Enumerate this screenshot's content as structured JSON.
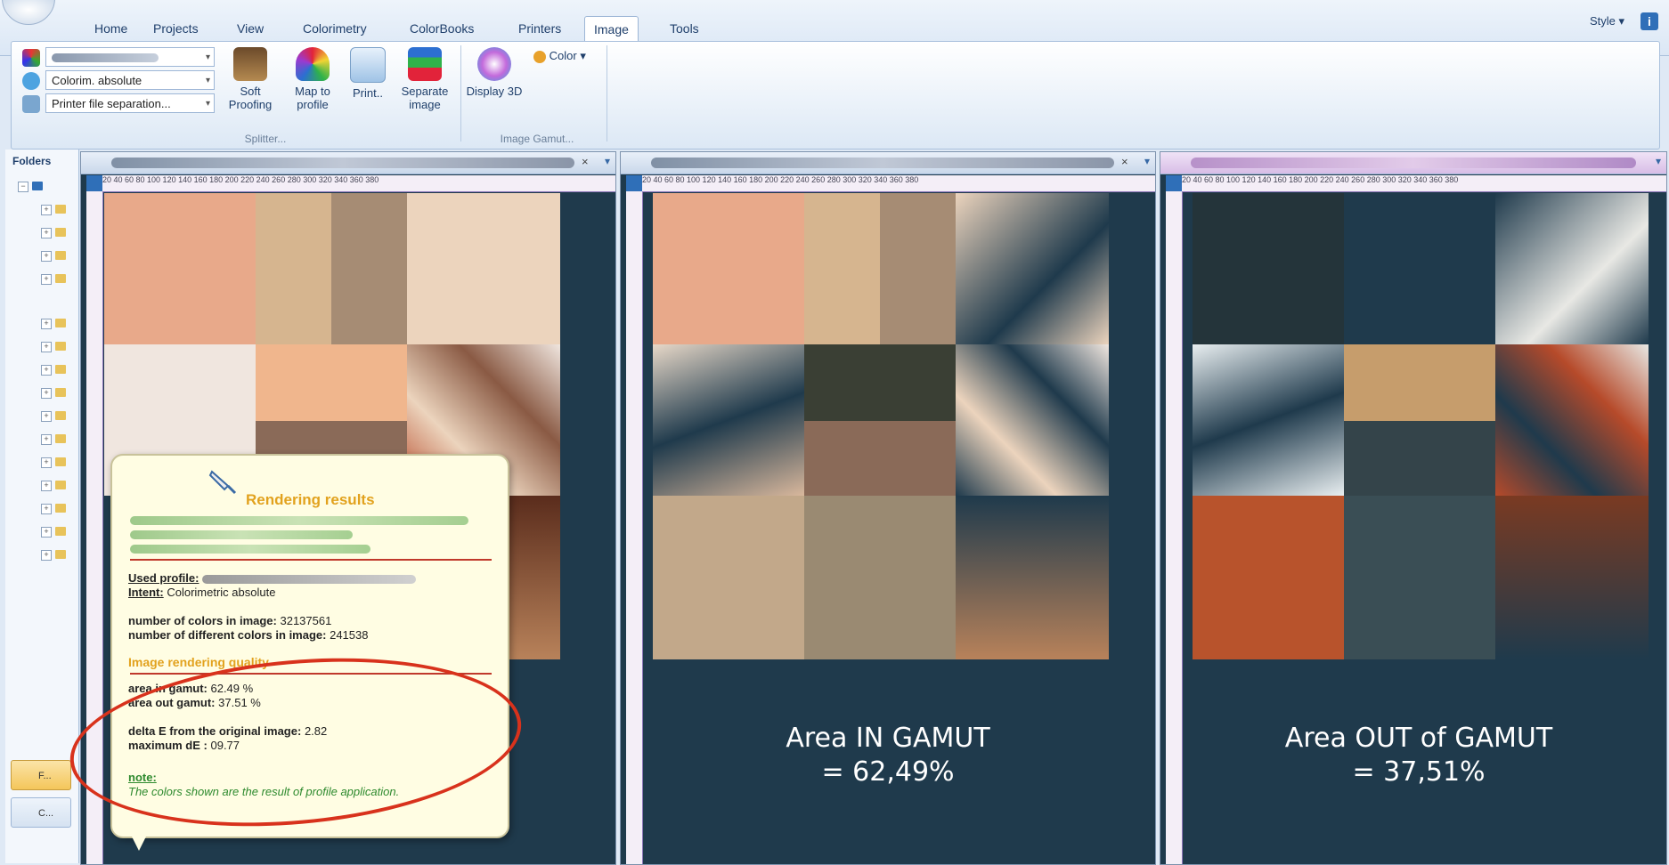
{
  "ribbon": {
    "tabs": [
      "Home",
      "Projects",
      "View",
      "Colorimetry",
      "ColorBooks",
      "Printers",
      "Image",
      "Tools"
    ],
    "active_tab": "Image",
    "style_label": "Style",
    "combos": [
      "",
      "Colorim. absolute",
      "Printer file separation..."
    ],
    "buttons": {
      "soft_proofing": "Soft Proofing",
      "map_to_profile": "Map to profile",
      "print": "Print..",
      "separate_image": "Separate image",
      "display_3d": "Display 3D",
      "color": "Color"
    },
    "groups": {
      "splitter": "Splitter...",
      "image_gamut": "Image Gamut..."
    }
  },
  "folders": {
    "title": "Folders",
    "btn1": "F...",
    "btn2": "C..."
  },
  "ruler_ticks": "20  40  60  80  100 120 140 160 180 200 220 240 260 280 300 320 340 360 380",
  "panels": {
    "middle_caption_1": "Area IN GAMUT",
    "middle_caption_2": "= 62,49%",
    "right_caption_1": "Area OUT of GAMUT",
    "right_caption_2": "= 37,51%"
  },
  "popup": {
    "title": "Rendering results",
    "used_profile_label": "Used profile:",
    "intent_label": "Intent:",
    "intent_value": "Colorimetric absolute",
    "num_colors_label": "number of colors in image:",
    "num_colors_value": "32137561",
    "num_diff_label": "number of different colors in image:",
    "num_diff_value": "241538",
    "quality_title": "Image rendering quality",
    "area_in_label": "area in gamut:",
    "area_in_value": "62.49 %",
    "area_out_label": "area out gamut:",
    "area_out_value": "37.51 %",
    "delta_label": "delta E from the original image:",
    "delta_value": "2.82",
    "max_label": "maximum dE :",
    "max_value": "09.77",
    "note_label": "note:",
    "note_text": "The colors shown are the result of profile application."
  }
}
